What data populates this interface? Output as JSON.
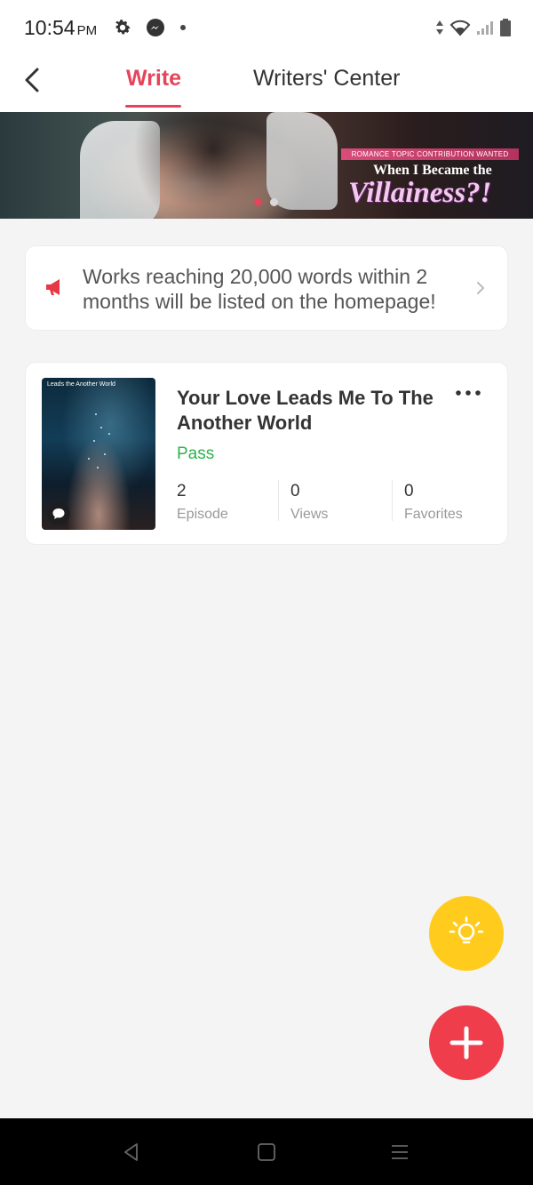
{
  "status_bar": {
    "time": "10:54",
    "ampm": "PM"
  },
  "header": {
    "tabs": [
      {
        "label": "Write",
        "active": true
      },
      {
        "label": "Writers' Center",
        "active": false
      }
    ]
  },
  "banner": {
    "tag": "ROMANCE TOPIC CONTRIBUTION WANTED",
    "title_line1": "When I Became the",
    "title_line2": "Villainess?!",
    "active_dot": 1,
    "dot_count": 2
  },
  "notice": {
    "text": "Works reaching 20,000 words within 2 months will  be listed on the homepage!"
  },
  "work": {
    "cover_text": "Leads  the Another World",
    "title": "Your Love Leads Me To The Another World",
    "status": "Pass",
    "stats": [
      {
        "value": "2",
        "label": "Episode"
      },
      {
        "value": "0",
        "label": "Views"
      },
      {
        "value": "0",
        "label": "Favorites"
      }
    ]
  },
  "colors": {
    "accent": "#e5445a",
    "status_pass": "#2db34a",
    "fab_idea": "#ffcc1e",
    "fab_add": "#ef3d4b"
  }
}
